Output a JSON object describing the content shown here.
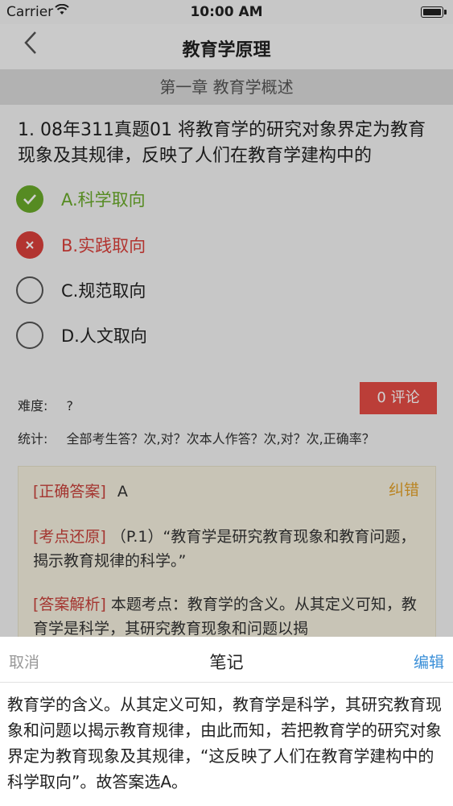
{
  "status_bar": {
    "carrier": "Carrier",
    "time": "10:00 AM"
  },
  "nav": {
    "title": "教育学原理"
  },
  "chapter": {
    "title": "第一章 教育学概述"
  },
  "question": {
    "text": "1. 08年311真题01 将教育学的研究对象界定为教育现象及其规律，反映了人们在教育学建构中的",
    "options": [
      {
        "label": "A.科学取向",
        "state": "correct"
      },
      {
        "label": "B.实践取向",
        "state": "wrong"
      },
      {
        "label": "C.规范取向",
        "state": "none"
      },
      {
        "label": "D.人文取向",
        "state": "none"
      }
    ]
  },
  "meta": {
    "difficulty_label": "难度:",
    "difficulty_value": "?",
    "stats_label": "统计:",
    "stats_value": "全部考生答？次,对？次本人作答？次,对？次,正确率？",
    "comment_button": "0 评论"
  },
  "answer": {
    "correction_label": "纠错",
    "correct_tag": "[正确答案]",
    "correct_value": "A",
    "origin_tag": "[考点还原]",
    "origin_text": "（P.1）“教育学是研究教育现象和教育问题，揭示教育规律的科学。”",
    "analysis_tag": "[答案解析]",
    "analysis_text": "本题考点：教育学的含义。从其定义可知，教育学是科学，其研究教育现象和问题以揭"
  },
  "note_sheet": {
    "cancel": "取消",
    "title": "笔记",
    "edit": "编辑",
    "body": "教育学的含义。从其定义可知，教育学是科学，其研究教育现象和问题以揭示教育规律，由此而知，若把教育学的研究对象界定为教育现象及其规律，“这反映了人们在教育学建构中的科学取向”。故答案选A。"
  },
  "colors": {
    "correct": "#6aaa2a",
    "wrong": "#d9403b",
    "accent_blue": "#3a8fd8",
    "comment_red": "#e44c45",
    "correction_orange": "#e3a12a"
  }
}
